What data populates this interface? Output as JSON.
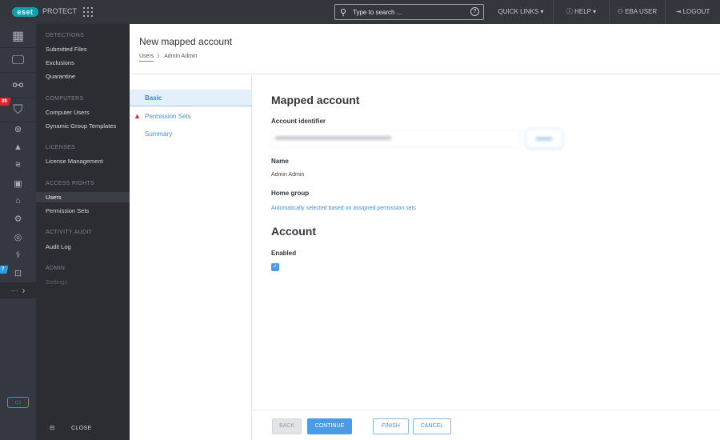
{
  "topbar": {
    "logo": "eset",
    "product": "PROTECT",
    "search_placeholder": "Type to search ...",
    "quick_links": "QUICK LINKS",
    "help": "HELP",
    "user": "EBA USER",
    "logout": "LOGOUT"
  },
  "iconbar": {
    "badges": {
      "detections": "89",
      "admin": "7"
    },
    "more": "···"
  },
  "menu": {
    "sections": [
      {
        "title": "DETECTIONS",
        "items": [
          "Submitted Files",
          "Exclusions",
          "Quarantine"
        ]
      },
      {
        "title": "COMPUTERS",
        "items": [
          "Computer Users",
          "Dynamic Group Templates"
        ]
      },
      {
        "title": "LICENSES",
        "items": [
          "License Management"
        ]
      },
      {
        "title": "ACCESS RIGHTS",
        "items": [
          "Users",
          "Permission Sets"
        ]
      },
      {
        "title": "ACTIVITY AUDIT",
        "items": [
          "Audit Log"
        ]
      },
      {
        "title": "ADMIN",
        "items": [
          "Settings"
        ]
      }
    ],
    "close": "CLOSE"
  },
  "header": {
    "title": "New mapped account",
    "breadcrumb": [
      "Users",
      "Admin Admin"
    ]
  },
  "steps": [
    "Basic",
    "Permission Sets",
    "Summary"
  ],
  "form": {
    "section1": "Mapped account",
    "account_identifier_label": "Account identifier",
    "name_label": "Name",
    "name_value": "Admin Admin",
    "home_group_label": "Home group",
    "home_group_value": "Automatically selected based on assigned permission sets",
    "section2": "Account",
    "enabled_label": "Enabled",
    "enabled": true
  },
  "footer": {
    "back": "BACK",
    "continue": "CONTINUE",
    "finish": "FINISH",
    "cancel": "CANCEL"
  },
  "colors": {
    "accent": "#4a9be6",
    "brand": "#0fa0ae",
    "error": "#d9272e",
    "badge_blue": "#2d9fe0"
  }
}
